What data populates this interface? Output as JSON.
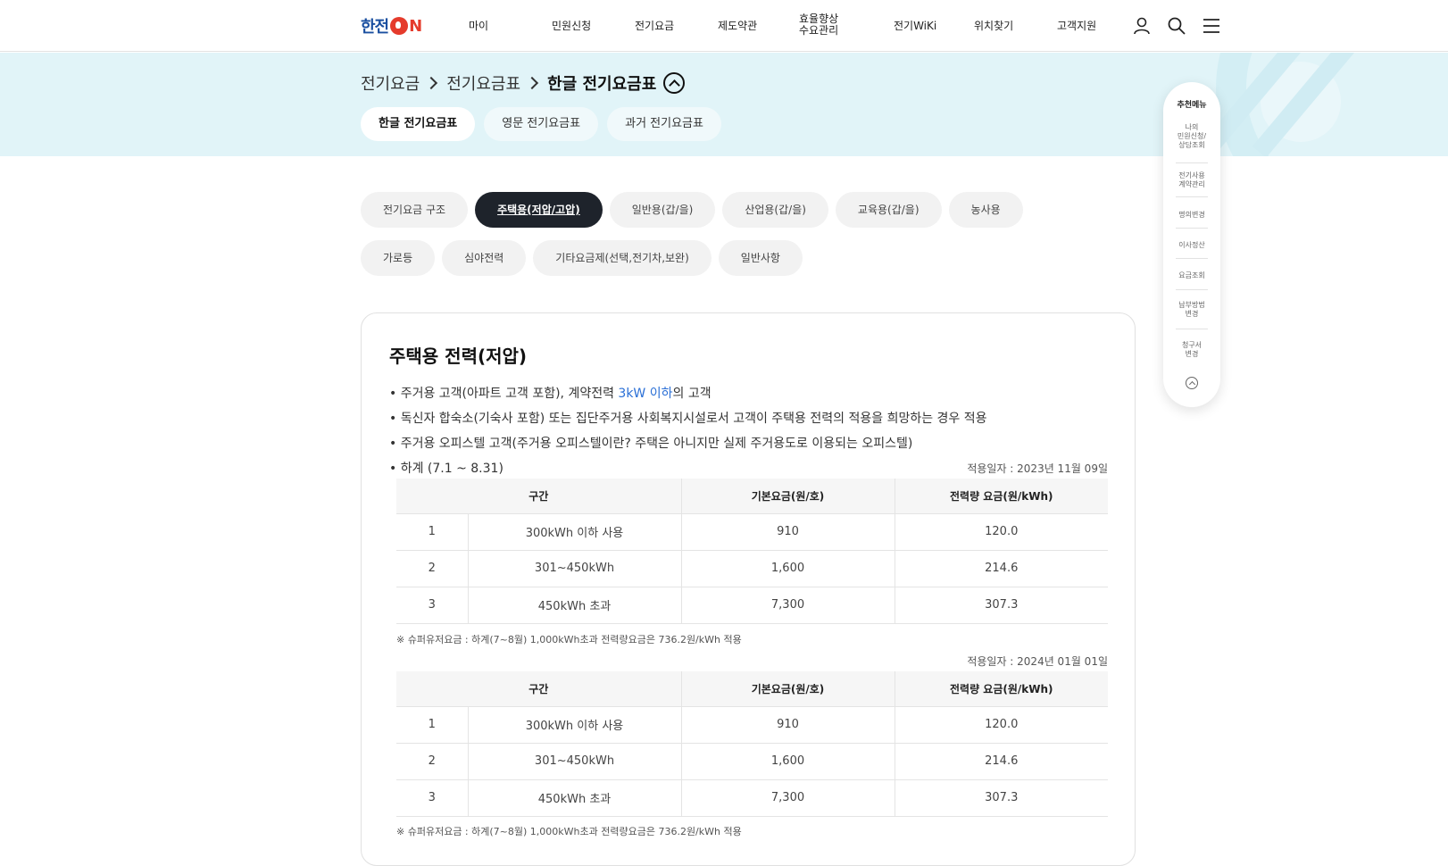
{
  "header": {
    "logo_text": "한전",
    "logo_on": "N",
    "nav": [
      "마이",
      "민원신청",
      "전기요금",
      "제도약관",
      "효율향상\n수요관리",
      "전기WiKi",
      "위치찾기",
      "고객지원"
    ],
    "icons": [
      "user-icon",
      "search-icon",
      "menu-icon"
    ]
  },
  "breadcrumb": {
    "items": [
      "전기요금",
      "전기요금표",
      "한글 전기요금표"
    ]
  },
  "subtabs": [
    "한글 전기요금표",
    "영문 전기요금표",
    "과거 전기요금표"
  ],
  "categories": [
    "전기요금 구조",
    "주택용(저압/고압)",
    "일반용(갑/을)",
    "산업용(갑/을)",
    "교육용(갑/을)",
    "농사용",
    "가로등",
    "심야전력",
    "기타요금제(선택,전기차,보완)",
    "일반사항"
  ],
  "content": {
    "title": "주택용 전력(저압)",
    "bullets": [
      {
        "pre": "• 주거용 고객(아파트 고객 포함), 계약전력 ",
        "hl": "3kW 이하",
        "post": "의 고객"
      },
      {
        "pre": "• 독신자 합숙소(기숙사 포함) 또는 집단주거용 사회복지시설로서 고객이 주택용 전력의 적용을 희망하는 경우 적용",
        "hl": "",
        "post": ""
      },
      {
        "pre": "• 주거용 오피스텔 고객(주거용 오피스텔이란? 주택은 아니지만 실제 주거용도로 이용되는 오피스텔)",
        "hl": "",
        "post": ""
      },
      {
        "pre": "• 하계 (7.1 ~ 8.31)",
        "hl": "",
        "post": ""
      }
    ],
    "tables": [
      {
        "date": "적용일자 : 2023년 11월 09일",
        "headers": [
          "구간",
          "기본요금(원/호)",
          "전력량 요금(원/kWh)"
        ],
        "rows": [
          [
            "1",
            "300kWh 이하 사용",
            "910",
            "120.0"
          ],
          [
            "2",
            "301~450kWh",
            "1,600",
            "214.6"
          ],
          [
            "3",
            "450kWh 초과",
            "7,300",
            "307.3"
          ]
        ],
        "note": "※ 슈퍼유저요금 : 하계(7~8월) 1,000kWh초과 전력량요금은 736.2원/kWh 적용"
      },
      {
        "date": "적용일자 : 2024년 01월 01일",
        "headers": [
          "구간",
          "기본요금(원/호)",
          "전력량 요금(원/kWh)"
        ],
        "rows": [
          [
            "1",
            "300kWh 이하 사용",
            "910",
            "120.0"
          ],
          [
            "2",
            "301~450kWh",
            "1,600",
            "214.6"
          ],
          [
            "3",
            "450kWh 초과",
            "7,300",
            "307.3"
          ]
        ],
        "note": "※ 슈퍼유저요금 : 하계(7~8월) 1,000kWh초과 전력량요금은 736.2원/kWh 적용"
      }
    ]
  },
  "quick_menu": {
    "title": "추천메뉴",
    "items": [
      "나의\n민원신청/\n상담조회",
      "전기사용\n계약관리",
      "명의변경",
      "이사정산",
      "요금조회",
      "납부방법\n변경",
      "청구서\n변경"
    ]
  }
}
